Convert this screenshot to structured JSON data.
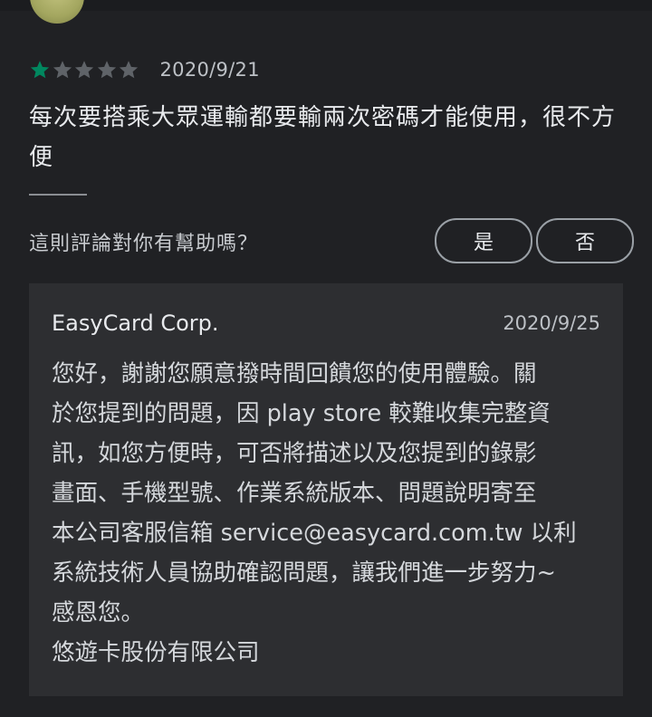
{
  "review": {
    "rating": 1,
    "max_rating": 5,
    "date": "2020/9/21",
    "text": "每次要搭乘大眾運輸都要輸兩次密碼才能使用，很不方便"
  },
  "helpful": {
    "question": "這則評論對你有幫助嗎？",
    "yes_label": "是",
    "no_label": "否"
  },
  "reply": {
    "author": "EasyCard Corp.",
    "date": "2020/9/25",
    "lines": [
      "您好，謝謝您願意撥時間回饋您的使用體驗。關",
      "於您提到的問題，因 play store 較難收集完整資",
      "訊，如您方便時，可否將描述以及您提到的錄影",
      "畫面、手機型號、作業系統版本、問題說明寄至",
      "本公司客服信箱 service@easycard.com.tw 以利",
      "系統技術人員協助確認問題，讓我們進一步努力~",
      "感恩您。",
      "悠遊卡股份有限公司"
    ]
  },
  "colors": {
    "star_filled": "#01875f",
    "star_empty": "#5f6368",
    "background": "#202124",
    "card": "#2d2e31"
  }
}
